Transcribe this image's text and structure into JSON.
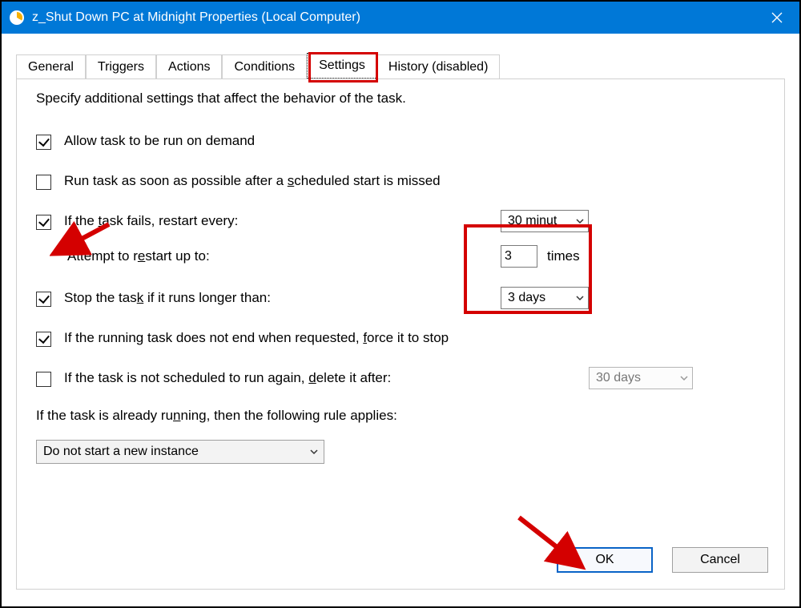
{
  "window": {
    "title": "z_Shut Down PC at Midnight Properties (Local Computer)"
  },
  "tabs": {
    "general": "General",
    "triggers": "Triggers",
    "actions": "Actions",
    "conditions": "Conditions",
    "settings": "Settings",
    "history": "History (disabled)"
  },
  "intro": "Specify additional settings that affect the behavior of the task.",
  "settings": {
    "allow_on_demand": "Allow task to be run on demand",
    "run_after_missed_pre": "Run task as soon as possible after a ",
    "run_after_missed_ul": "s",
    "run_after_missed_post": "cheduled start is missed",
    "restart_every_pre": "If the ",
    "restart_every_ul": "t",
    "restart_every_post": "ask fails, restart every:",
    "restart_value": "30 minut",
    "attempt_pre": "Attempt to r",
    "attempt_ul": "e",
    "attempt_post": "start up to:",
    "attempt_count": "3",
    "attempt_times": "times",
    "stop_longer_pre": "Stop the tas",
    "stop_longer_ul": "k",
    "stop_longer_post": " if it runs longer than:",
    "stop_longer_value": "3 days",
    "force_stop_pre": "If the running task does not end when requested, ",
    "force_stop_ul": "f",
    "force_stop_post": "orce it to stop",
    "delete_after_pre": "If the task is not scheduled to run again, ",
    "delete_after_ul": "d",
    "delete_after_post": "elete it after:",
    "delete_after_value": "30 days",
    "rule_pre": "If the task is already ru",
    "rule_ul": "n",
    "rule_post": "ning, then the following rule applies:",
    "rule_value": "Do not start a new instance"
  },
  "buttons": {
    "ok": "OK",
    "cancel": "Cancel"
  }
}
